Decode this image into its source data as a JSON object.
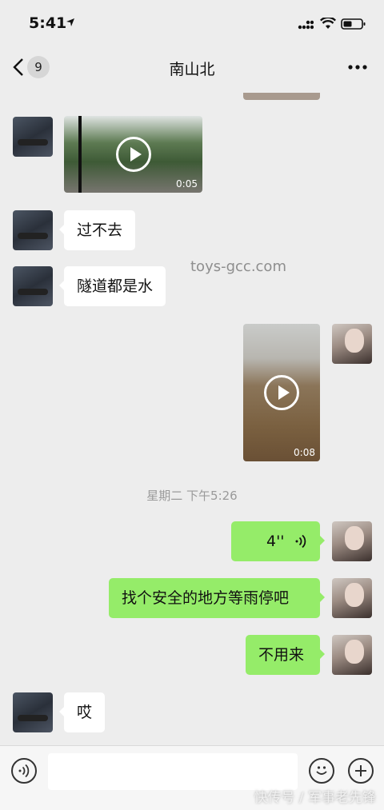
{
  "status": {
    "time": "5:41"
  },
  "nav": {
    "badge": "9",
    "title": "南山北"
  },
  "messages": {
    "video1_duration": "0:05",
    "text1": "过不去",
    "text2": "隧道都是水",
    "video2_duration": "0:08",
    "timestamp": "星期二 下午5:26",
    "voice_duration": "4''",
    "text3": "找个安全的地方等雨停吧",
    "text4": "不用来",
    "text5": "哎"
  },
  "overlay": {
    "watermark": "toys-gcc.com",
    "source": "快传号 / 军事老先锋"
  },
  "colors": {
    "self_bubble": "#95ec69",
    "other_bubble": "#ffffff",
    "background": "#ededed"
  }
}
